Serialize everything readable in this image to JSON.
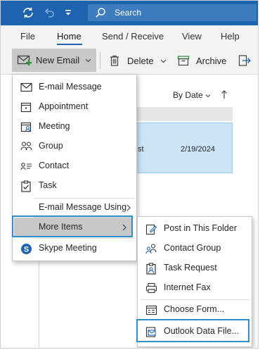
{
  "titlebar": {
    "search_placeholder": "Search",
    "icons": [
      "sync-icon",
      "undo-icon",
      "quick-access-dropdown-icon",
      "search-icon"
    ],
    "bg_color": "#1e63b0"
  },
  "ribbon_tabs": [
    {
      "label": "File",
      "active": false
    },
    {
      "label": "Home",
      "active": true
    },
    {
      "label": "Send / Receive",
      "active": false
    },
    {
      "label": "View",
      "active": false
    },
    {
      "label": "Help",
      "active": false
    }
  ],
  "ribbon_commands": {
    "new_email": "New Email",
    "delete": "Delete",
    "archive": "Archive"
  },
  "mail_list": {
    "sort_label": "By Date",
    "row_fragment": "st",
    "row_date": "2/19/2024",
    "selected_color": "#cce4f7"
  },
  "new_items_menu": {
    "items": [
      {
        "label": "E-mail Message",
        "icon": "envelope-icon"
      },
      {
        "label": "Appointment",
        "icon": "calendar-icon"
      },
      {
        "label": "Meeting",
        "icon": "meeting-icon"
      },
      {
        "label": "Group",
        "icon": "group-icon"
      },
      {
        "label": "Contact",
        "icon": "contact-card-icon"
      },
      {
        "label": "Task",
        "icon": "task-clipboard-icon"
      }
    ],
    "using_label": "E-mail Message Using",
    "more_items_label": "More Items",
    "skype_label": "Skype Meeting"
  },
  "more_items_submenu": {
    "items": [
      {
        "label": "Post in This Folder",
        "icon": "post-icon"
      },
      {
        "label": "Contact Group",
        "icon": "contact-group-icon"
      },
      {
        "label": "Task Request",
        "icon": "task-request-icon"
      },
      {
        "label": "Internet Fax",
        "icon": "fax-icon"
      }
    ],
    "choose_form_label": "Choose Form...",
    "data_file_label": "Outlook Data File..."
  },
  "highlight_color": "#2e8fc9"
}
